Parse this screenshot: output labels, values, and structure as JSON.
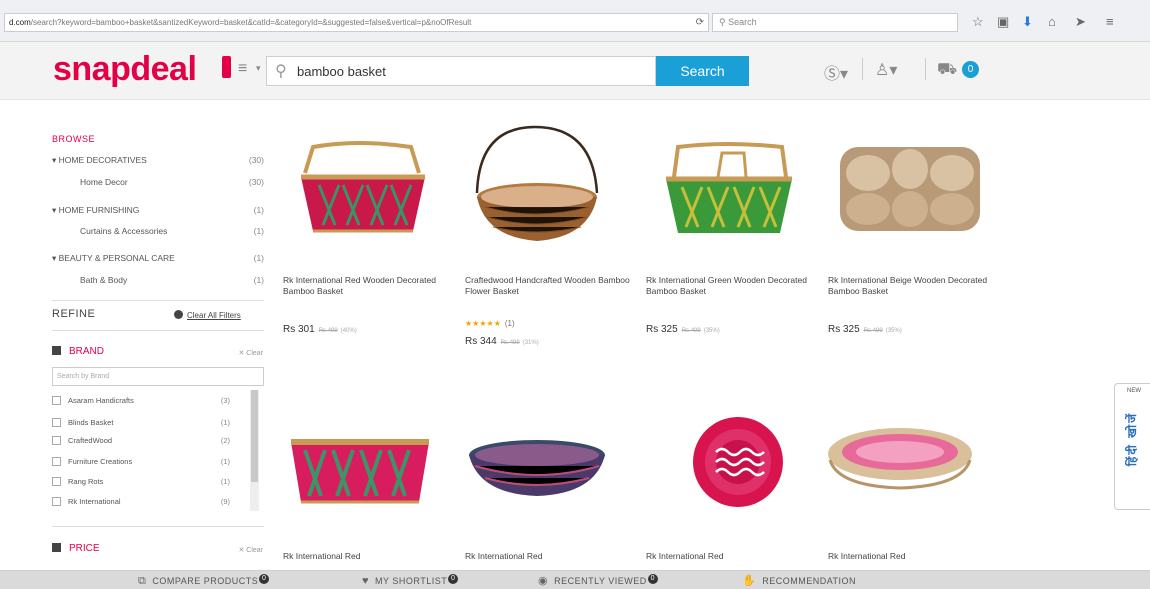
{
  "browser": {
    "url_host": "d.com",
    "url_rest": "/search?keyword=bamboo+basket&santizedKeyword=basket&catId=&categoryId=&suggested=false&vertical=p&noOfResult",
    "search_placeholder": "Search",
    "icons": [
      "reload-icon",
      "star-icon",
      "clipboard-icon",
      "download-icon",
      "home-icon",
      "send-icon",
      "menu-icon"
    ]
  },
  "header": {
    "logo": "snapdeal",
    "search_query": "bamboo basket",
    "search_button": "Search",
    "cart_count": "0",
    "colors": {
      "brand": "#e40046",
      "accent": "#1a9fd6"
    }
  },
  "sidebar": {
    "browse_title": "BROWSE",
    "categories": [
      {
        "label": "▾ HOME DECORATIVES",
        "count": "(30)"
      },
      {
        "label": "Home Decor",
        "count": "(30)"
      },
      {
        "label": "▾ HOME FURNISHING",
        "count": "(1)"
      },
      {
        "label": "Curtains & Accessories",
        "count": "(1)"
      },
      {
        "label": "▾ BEAUTY & PERSONAL CARE",
        "count": "(1)"
      },
      {
        "label": "Bath & Body",
        "count": "(1)"
      }
    ],
    "refine_title": "REFINE",
    "clear_all": "Clear All Filters",
    "brand": {
      "title": "BRAND",
      "clear": "✕ Clear",
      "search_placeholder": "Search by Brand",
      "items": [
        {
          "label": "Asaram Handicrafts",
          "count": "(3)"
        },
        {
          "label": "Blinds Basket",
          "count": "(1)"
        },
        {
          "label": "CraftedWood",
          "count": "(2)"
        },
        {
          "label": "Furniture Creations",
          "count": "(1)"
        },
        {
          "label": "Rang Rots",
          "count": "(1)"
        },
        {
          "label": "Rk International",
          "count": "(9)"
        }
      ]
    },
    "price": {
      "title": "PRICE",
      "clear": "✕ Clear"
    }
  },
  "products": [
    {
      "name": "Rk International Red Wooden Decorated Bamboo Basket",
      "price": "Rs 301",
      "mrp": "Rs 499",
      "discount": "(40%)",
      "rating": "",
      "rating_count": ""
    },
    {
      "name": "Craftedwood Handcrafted Wooden Bamboo Flower Basket",
      "price": "Rs 344",
      "mrp": "Rs 499",
      "discount": "(31%)",
      "rating": "★★★★★",
      "rating_count": "(1)"
    },
    {
      "name": "Rk International Green Wooden Decorated Bamboo Basket",
      "price": "Rs 325",
      "mrp": "Rs 499",
      "discount": "(35%)",
      "rating": "",
      "rating_count": ""
    },
    {
      "name": "Rk International Beige Wooden Decorated Bamboo Basket",
      "price": "Rs 325",
      "mrp": "Rs 499",
      "discount": "(35%)",
      "rating": "",
      "rating_count": ""
    },
    {
      "name": "Rk International Red",
      "price": "",
      "mrp": "",
      "discount": "",
      "rating": "",
      "rating_count": ""
    },
    {
      "name": "Rk International Red",
      "price": "",
      "mrp": "",
      "discount": "",
      "rating": "",
      "rating_count": ""
    },
    {
      "name": "Rk International Red",
      "price": "",
      "mrp": "",
      "discount": "",
      "rating": "",
      "rating_count": ""
    },
    {
      "name": "Rk International Red",
      "price": "",
      "mrp": "",
      "discount": "",
      "rating": "",
      "rating_count": ""
    }
  ],
  "side_tab": {
    "badge": "NEW",
    "label": "हिंदी खोजें"
  },
  "bottom_bar": {
    "compare": "COMPARE PRODUCTS",
    "shortlist": "MY SHORTLIST",
    "recent": "RECENTLY VIEWED",
    "recommend": "RECOMMENDATION",
    "badge": "0"
  }
}
